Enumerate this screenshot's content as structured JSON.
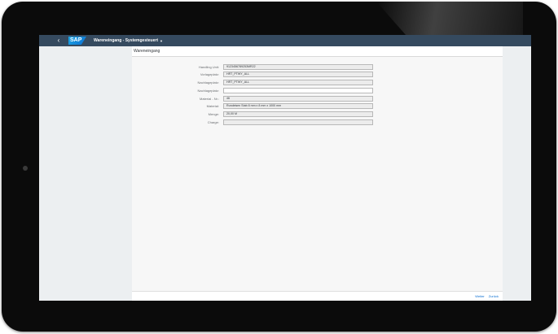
{
  "shell": {
    "back_glyph": "‹",
    "logo_text": "SAP",
    "app_title": "Wareneingang - Systemgesteuert",
    "dropdown_glyph": "▼"
  },
  "page": {
    "title": "Wareneingang"
  },
  "form": {
    "fields": [
      {
        "label": "Handling Unit:",
        "value": "9123456789253MR22",
        "editable": false
      },
      {
        "label": "Vorlageplatz:",
        "value": "HRT_PTWY_ALL",
        "editable": false
      },
      {
        "label": "Nachlageplatz:",
        "value": "HRT_PTWY_ALL",
        "editable": false
      },
      {
        "label": "Nachlageplatz:",
        "value": "",
        "editable": true
      },
      {
        "label": "Material - Nr.:",
        "value": "46",
        "editable": false
      },
      {
        "label": "Material:",
        "value": "Rundeisen Stab 8 mm x 8 mm x 1000 mm",
        "editable": false
      },
      {
        "label": "Menge:",
        "value": "20,00 M",
        "editable": false
      },
      {
        "label": "Charge:",
        "value": "",
        "editable": false
      }
    ]
  },
  "footer": {
    "next_label": "Weiter",
    "back_label": "Zurück"
  },
  "colors": {
    "shellbar": "#354a5f",
    "link": "#0a6ed1"
  }
}
